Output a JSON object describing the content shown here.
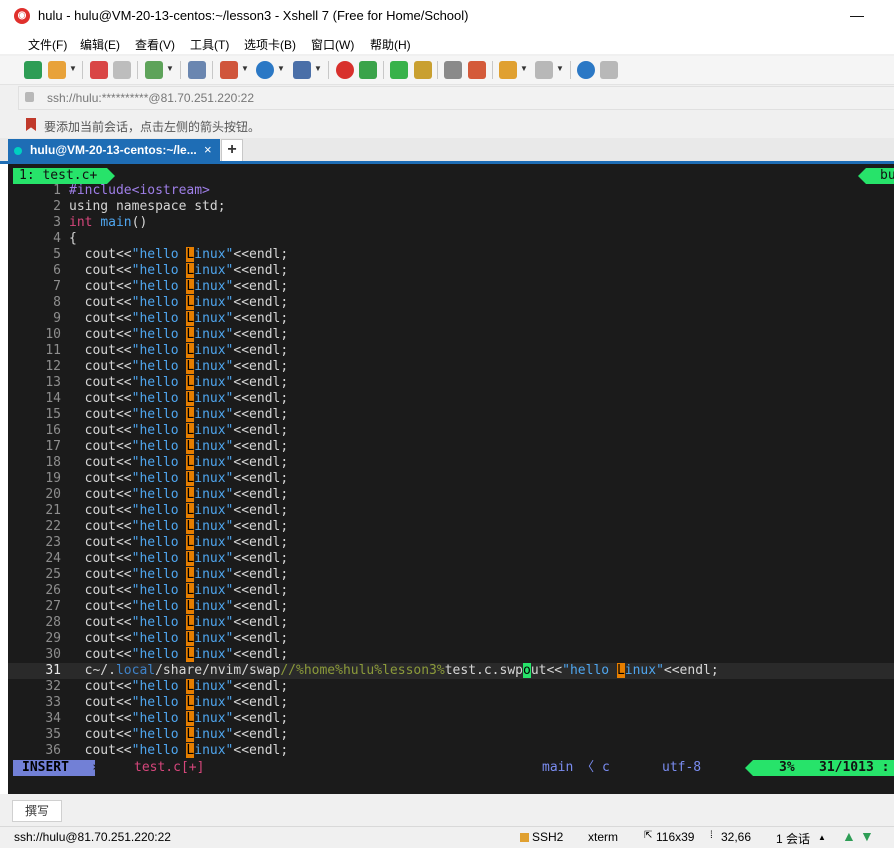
{
  "window": {
    "title": "hulu - hulu@VM-20-13-centos:~/lesson3 - Xshell 7 (Free for Home/School)",
    "minimize": "—"
  },
  "menu": [
    "文件(F)",
    "编辑(E)",
    "查看(V)",
    "工具(T)",
    "选项卡(B)",
    "窗口(W)",
    "帮助(H)"
  ],
  "address": "ssh://hulu:**********@81.70.251.220:22",
  "tip": "要添加当前会话，点击左侧的箭头按钮。",
  "tab": {
    "label": "hulu@VM-20-13-centos:~/le...",
    "close": "×",
    "new": "+"
  },
  "editor": {
    "buffer_tab": "1: test.c+",
    "buffer_right": "buf",
    "header_lines": [
      {
        "num": "1",
        "parts": [
          {
            "t": "#include<iostream>",
            "c": "pre"
          }
        ]
      },
      {
        "num": "2",
        "parts": [
          {
            "t": "using namespace std;",
            "c": "src"
          }
        ]
      },
      {
        "num": "3",
        "parts": [
          {
            "t": "int",
            "c": "kw"
          },
          {
            "t": " ",
            "c": "src"
          },
          {
            "t": "main",
            "c": "fn"
          },
          {
            "t": "()",
            "c": "src"
          }
        ]
      },
      {
        "num": "4",
        "parts": [
          {
            "t": "{",
            "c": "src"
          }
        ]
      }
    ],
    "cout_prefix": "  cout<<",
    "cout_str_a": "\"hello ",
    "cout_cursor_char": "L",
    "cout_str_b": "inux\"",
    "cout_suffix": "<<endl;",
    "cout_line_numbers_before": [
      "5",
      "6",
      "7",
      "8",
      "9",
      "10",
      "11",
      "12",
      "13",
      "14",
      "15",
      "16",
      "17",
      "18",
      "19",
      "20",
      "21",
      "22",
      "23",
      "24",
      "25",
      "26",
      "27",
      "28",
      "29",
      "30"
    ],
    "current_line": {
      "num": "31",
      "parts": [
        {
          "t": "  c~/.",
          "c": "src"
        },
        {
          "t": "local",
          "c": "path"
        },
        {
          "t": "/share/nvim/swap",
          "c": "src"
        },
        {
          "t": "//%home%hulu%lesson3%",
          "c": "cmt"
        },
        {
          "t": "test.c.swp",
          "c": "src"
        },
        {
          "t": "o",
          "c": "grn"
        },
        {
          "t": "ut<<",
          "c": "src"
        },
        {
          "t": "\"hello ",
          "c": "str"
        },
        {
          "t": "L",
          "c": "caretbox"
        },
        {
          "t": "inux\"",
          "c": "str"
        },
        {
          "t": "<<endl;",
          "c": "src"
        }
      ]
    },
    "cout_line_numbers_after": [
      "32",
      "33",
      "34",
      "35",
      "36"
    ]
  },
  "vim_status": {
    "mode": "INSERT",
    "mode_arrow": "›",
    "file": "test.c[+]",
    "branch": "main 〈 c",
    "encoding": "utf-8",
    "percent": "3%",
    "linecol": "31/1013 :"
  },
  "compose": "撰写",
  "statusbar": {
    "connection": "ssh://hulu@81.70.251.220:22",
    "protocol": "SSH2",
    "terminal": "xterm",
    "size": "116x39",
    "cursor": "32,66",
    "sessions": "1 会话"
  },
  "colors": {
    "accent": "#1e6db5",
    "green": "#27e36a",
    "orange": "#e67e00",
    "insert": "#7280d6"
  }
}
